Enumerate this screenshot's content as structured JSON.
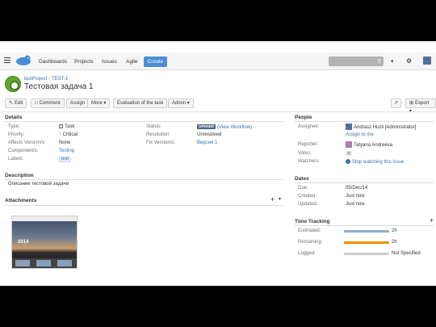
{
  "nav": {
    "links": [
      "Dashboards",
      "Projects",
      "Issues",
      "Agile"
    ],
    "create_label": "Create"
  },
  "header": {
    "project": "testProject",
    "issue_key": "TEST-1",
    "title": "Тестовая задача 1"
  },
  "toolbar": {
    "edit": "Edit",
    "comment": "Comment",
    "assign": "Assign",
    "more": "More",
    "evaluation": "Evaluation of the task",
    "admin": "Admin",
    "export": "Export"
  },
  "details": {
    "heading": "Details",
    "type_label": "Type:",
    "type_value": "Task",
    "priority_label": "Priority:",
    "priority_value": "Critical",
    "affects_label": "Affects Version/s:",
    "affects_value": "None",
    "components_label": "Component/s:",
    "components_value": "Testing",
    "labels_label": "Labels:",
    "labels_value": "test",
    "status_label": "Status:",
    "status_value": "OPENED",
    "status_link": "(View Workflow)",
    "resolution_label": "Resolution:",
    "resolution_value": "Unresolved",
    "fix_label": "Fix Version/s:",
    "fix_value": "Версия 1"
  },
  "description": {
    "heading": "Description",
    "text": "Описание тестовой задачи"
  },
  "attachments": {
    "heading": "Attachments",
    "thumb_text": "2014"
  },
  "people": {
    "heading": "People",
    "assignee_label": "Assignee:",
    "assignee_value": "Andrasz Huzli [Administrator]",
    "assign_me": "Assign to me",
    "reporter_label": "Reporter:",
    "reporter_value": "Tatyana Andreeva",
    "votes_label": "Votes:",
    "votes_value": "0",
    "watchers_label": "Watchers:",
    "watchers_value": "Stop watching this issue"
  },
  "dates": {
    "heading": "Dates",
    "due_label": "Due:",
    "due_value": "05/Dec/14",
    "created_label": "Created:",
    "created_value": "Just now",
    "updated_label": "Updated:",
    "updated_value": "Just now"
  },
  "time_tracking": {
    "heading": "Time Tracking",
    "estimated_label": "Estimated:",
    "estimated_value": "2h",
    "estimated_fraction": 1.0,
    "remaining_label": "Remaining:",
    "remaining_value": "2h",
    "remaining_fraction": 1.0,
    "logged_label": "Logged:",
    "logged_value": "Not Specified",
    "logged_fraction": 0.0
  },
  "colors": {
    "accent": "#3572b0",
    "estimated_bar": "#89afd7",
    "remaining_bar": "#ec8e00",
    "logged_bar": "#cccccc"
  }
}
